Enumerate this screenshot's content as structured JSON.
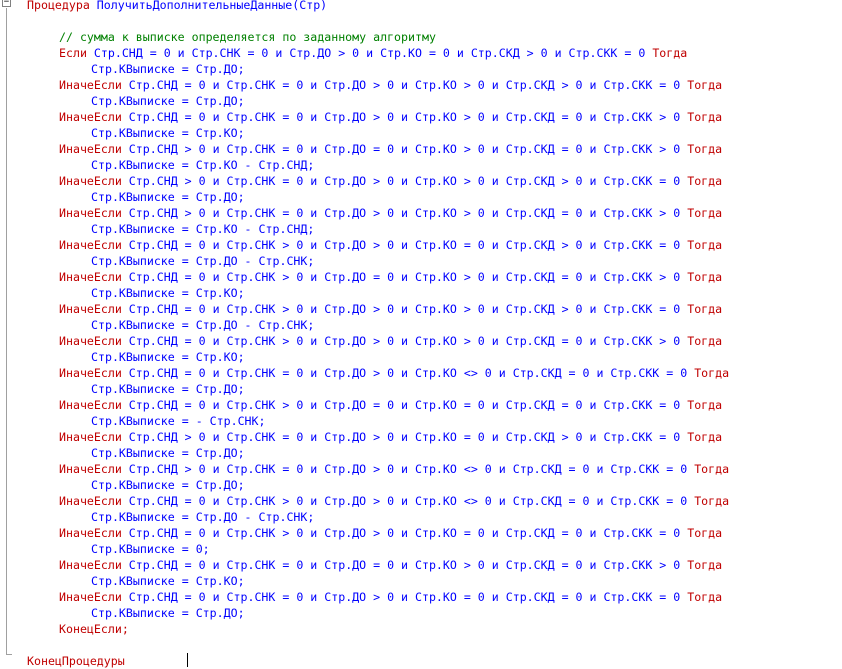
{
  "editor": {
    "fold_symbol": "−",
    "proc_keyword": "Процедура",
    "proc_header": " ПолучитьДополнительныеДанные(Стр)",
    "comment": "// сумма к выписке определяется по заданному алгоритму",
    "end_if": "КонецЕсли;",
    "end_proc": "КонецПроцедуры",
    "lines": [
      {
        "kw": "Если",
        "cond": " Стр.СНД = 0 и Стр.СНК = 0 и Стр.ДО > 0 и Стр.КО = 0 и Стр.СКД > 0 и Стр.СКК = 0 ",
        "then": "Тогда",
        "body": "Стр.КВыписке = Стр.ДО;"
      },
      {
        "kw": "ИначеЕсли",
        "cond": " Стр.СНД = 0 и Стр.СНК = 0 и Стр.ДО > 0 и Стр.КО > 0 и Стр.СКД > 0 и Стр.СКК = 0 ",
        "then": "Тогда",
        "body": "Стр.КВыписке = Стр.ДО;"
      },
      {
        "kw": "ИначеЕсли",
        "cond": " Стр.СНД = 0 и Стр.СНК = 0 и Стр.ДО > 0 и Стр.КО > 0 и Стр.СКД = 0 и Стр.СКК > 0 ",
        "then": "Тогда",
        "body": "Стр.КВыписке = Стр.КО;"
      },
      {
        "kw": "ИначеЕсли",
        "cond": " Стр.СНД > 0 и Стр.СНК = 0 и Стр.ДО = 0 и Стр.КО > 0 и Стр.СКД = 0 и Стр.СКК > 0 ",
        "then": "Тогда",
        "body": "Стр.КВыписке = Стр.КО - Стр.СНД;"
      },
      {
        "kw": "ИначеЕсли",
        "cond": " Стр.СНД > 0 и Стр.СНК = 0 и Стр.ДО > 0 и Стр.КО > 0 и Стр.СКД > 0 и Стр.СКК = 0 ",
        "then": "Тогда",
        "body": "Стр.КВыписке = Стр.ДО;"
      },
      {
        "kw": "ИначеЕсли",
        "cond": " Стр.СНД > 0 и Стр.СНК = 0 и Стр.ДО > 0 и Стр.КО > 0 и Стр.СКД = 0 и Стр.СКК > 0 ",
        "then": "Тогда",
        "body": "Стр.КВыписке = Стр.КО - Стр.СНД;"
      },
      {
        "kw": "ИначеЕсли",
        "cond": " Стр.СНД = 0 и Стр.СНК > 0 и Стр.ДО > 0 и Стр.КО = 0 и Стр.СКД > 0 и Стр.СКК = 0 ",
        "then": "Тогда",
        "body": "Стр.КВыписке = Стр.ДО - Стр.СНК;"
      },
      {
        "kw": "ИначеЕсли",
        "cond": " Стр.СНД = 0 и Стр.СНК > 0 и Стр.ДО = 0 и Стр.КО > 0 и Стр.СКД = 0 и Стр.СКК > 0 ",
        "then": "Тогда",
        "body": "Стр.КВыписке = Стр.КО;"
      },
      {
        "kw": "ИначеЕсли",
        "cond": " Стр.СНД = 0 и Стр.СНК > 0 и Стр.ДО > 0 и Стр.КО > 0 и Стр.СКД > 0 и Стр.СКК = 0 ",
        "then": "Тогда",
        "body": "Стр.КВыписке = Стр.ДО - Стр.СНК;"
      },
      {
        "kw": "ИначеЕсли",
        "cond": " Стр.СНД = 0 и Стр.СНК > 0 и Стр.ДО > 0 и Стр.КО > 0 и Стр.СКД = 0 и Стр.СКК > 0 ",
        "then": "Тогда",
        "body": "Стр.КВыписке = Стр.КО;"
      },
      {
        "kw": "ИначеЕсли",
        "cond": " Стр.СНД = 0 и Стр.СНК = 0 и Стр.ДО > 0 и Стр.КО <> 0 и Стр.СКД = 0 и Стр.СКК = 0 ",
        "then": "Тогда",
        "body": "Стр.КВыписке = Стр.ДО;"
      },
      {
        "kw": "ИначеЕсли",
        "cond": " Стр.СНД = 0 и Стр.СНК > 0 и Стр.ДО = 0 и Стр.КО = 0 и Стр.СКД = 0 и Стр.СКК = 0 ",
        "then": "Тогда",
        "body": "Стр.КВыписке = - Стр.СНК;"
      },
      {
        "kw": "ИначеЕсли",
        "cond": " Стр.СНД > 0 и Стр.СНК = 0 и Стр.ДО > 0 и Стр.КО = 0 и Стр.СКД > 0 и Стр.СКК = 0 ",
        "then": "Тогда",
        "body": "Стр.КВыписке = Стр.ДО;"
      },
      {
        "kw": "ИначеЕсли",
        "cond": " Стр.СНД > 0 и Стр.СНК = 0 и Стр.ДО > 0 и Стр.КО <> 0 и Стр.СКД = 0 и Стр.СКК = 0 ",
        "then": "Тогда",
        "body": "Стр.КВыписке = Стр.ДО;"
      },
      {
        "kw": "ИначеЕсли",
        "cond": " Стр.СНД = 0 и Стр.СНК > 0 и Стр.ДО > 0 и Стр.КО <> 0 и Стр.СКД = 0 и Стр.СКК = 0 ",
        "then": "Тогда",
        "body": "Стр.КВыписке = Стр.ДО - Стр.СНК;"
      },
      {
        "kw": "ИначеЕсли",
        "cond": " Стр.СНД = 0 и Стр.СНК > 0 и Стр.ДО > 0 и Стр.КО = 0 и Стр.СКД = 0 и Стр.СКК = 0 ",
        "then": "Тогда",
        "body": "Стр.КВыписке = 0;"
      },
      {
        "kw": "ИначеЕсли",
        "cond": " Стр.СНД = 0 и Стр.СНК = 0 и Стр.ДО = 0 и Стр.КО > 0 и Стр.СКД = 0 и Стр.СКК > 0 ",
        "then": "Тогда",
        "body": "Стр.КВыписке = Стр.КО;"
      },
      {
        "kw": "ИначеЕсли",
        "cond": " Стр.СНД = 0 и Стр.СНК = 0 и Стр.ДО > 0 и Стр.КО = 0 и Стр.СКД = 0 и Стр.СКК = 0 ",
        "then": "Тогда",
        "body": "Стр.КВыписке = Стр.ДО;"
      }
    ]
  }
}
